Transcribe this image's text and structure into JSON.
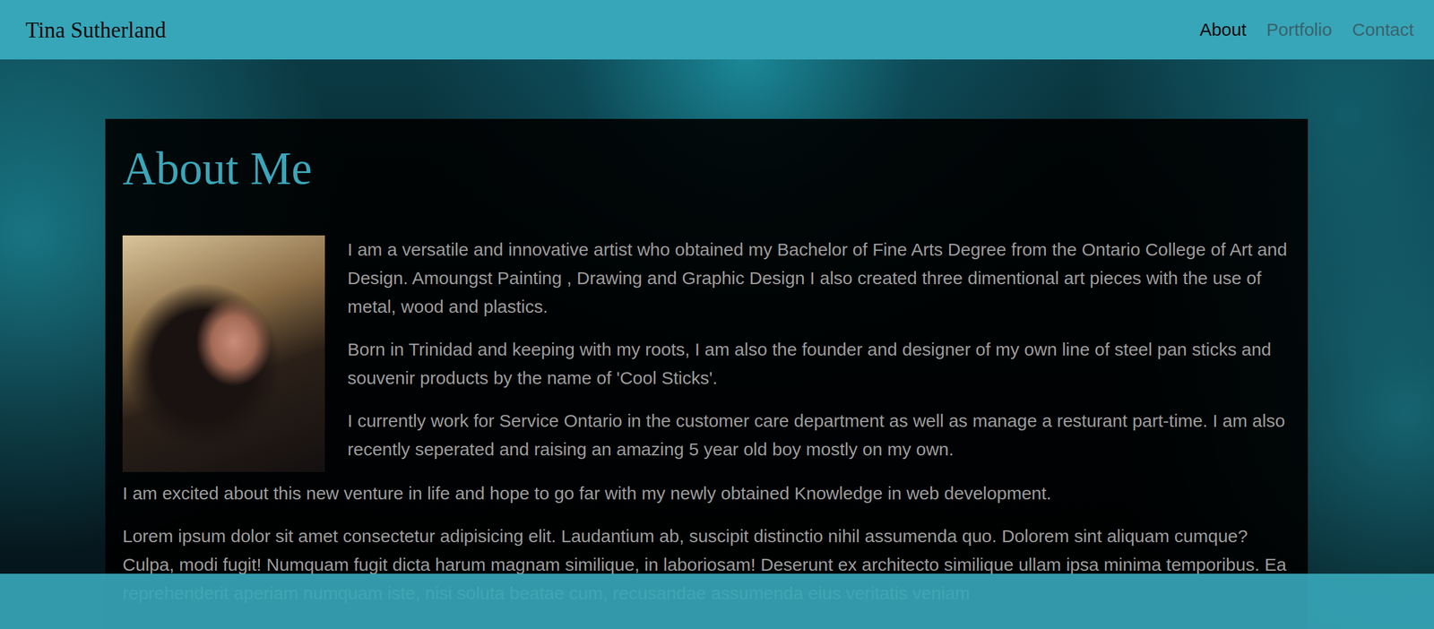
{
  "nav": {
    "brand": "Tina Sutherland",
    "links": [
      {
        "label": "About",
        "selected": true
      },
      {
        "label": "Portfolio",
        "selected": false
      },
      {
        "label": "Contact",
        "selected": false
      }
    ]
  },
  "about": {
    "heading": "About Me",
    "beside_photo": [
      "I am a versatile and innovative artist who obtained my Bachelor of Fine Arts Degree from the Ontario College of Art and Design. Amoungst Painting , Drawing and Graphic Design I also created three dimentional art pieces with the use of metal, wood and plastics.",
      "Born in Trinidad and keeping with my roots, I am also the founder and designer of my own line of steel pan sticks and souvenir products by the name of 'Cool Sticks'.",
      "I currently work for Service Ontario in the customer care department as well as manage a resturant part-time. I am also recently seperated and raising an amazing 5 year old boy mostly on my own."
    ],
    "below_photo": [
      "I am excited about this new venture in life and hope to go far with my newly obtained Knowledge in web development.",
      "Lorem ipsum dolor sit amet consectetur adipisicing elit. Laudantium ab, suscipit distinctio nihil assumenda quo. Dolorem sint aliquam cumque? Culpa, modi fugit! Numquam fugit dicta harum magnam similique, in laboriosam! Deserunt ex architecto similique ullam ipsa minima temporibus. Ea reprehenderit aperiam numquam iste, nisi soluta beatae cum, recusandae assumenda eius veritatis veniam"
    ]
  }
}
